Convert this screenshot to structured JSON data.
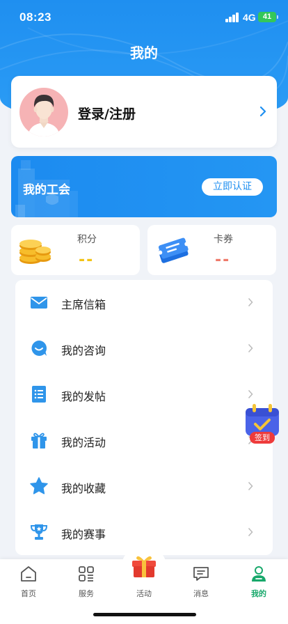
{
  "status_bar": {
    "time": "08:23",
    "network": "4G",
    "battery": "41"
  },
  "page_title": "我的",
  "profile": {
    "login_label": "登录/注册"
  },
  "union": {
    "title": "我的工会",
    "certify_button": "立即认证"
  },
  "points": {
    "label": "积分",
    "value": "--"
  },
  "coupons": {
    "label": "卡券",
    "value": "--"
  },
  "menu": [
    {
      "label": "主席信箱",
      "icon": "mail-icon"
    },
    {
      "label": "我的咨询",
      "icon": "chat-icon"
    },
    {
      "label": "我的发帖",
      "icon": "list-icon"
    },
    {
      "label": "我的活动",
      "icon": "gift-icon"
    },
    {
      "label": "我的收藏",
      "icon": "star-icon"
    },
    {
      "label": "我的赛事",
      "icon": "trophy-icon"
    }
  ],
  "checkin": {
    "label": "签到"
  },
  "tabbar": [
    {
      "label": "首页",
      "icon": "home-icon"
    },
    {
      "label": "服务",
      "icon": "grid-icon"
    },
    {
      "label": "活动",
      "icon": "gift-box-icon"
    },
    {
      "label": "消息",
      "icon": "message-icon"
    },
    {
      "label": "我的",
      "icon": "user-icon",
      "active": true
    }
  ],
  "colors": {
    "primary": "#1f8ff0",
    "active_tab": "#18a86b",
    "points_value": "#f2c316",
    "coupons_value": "#ef7a6a"
  }
}
